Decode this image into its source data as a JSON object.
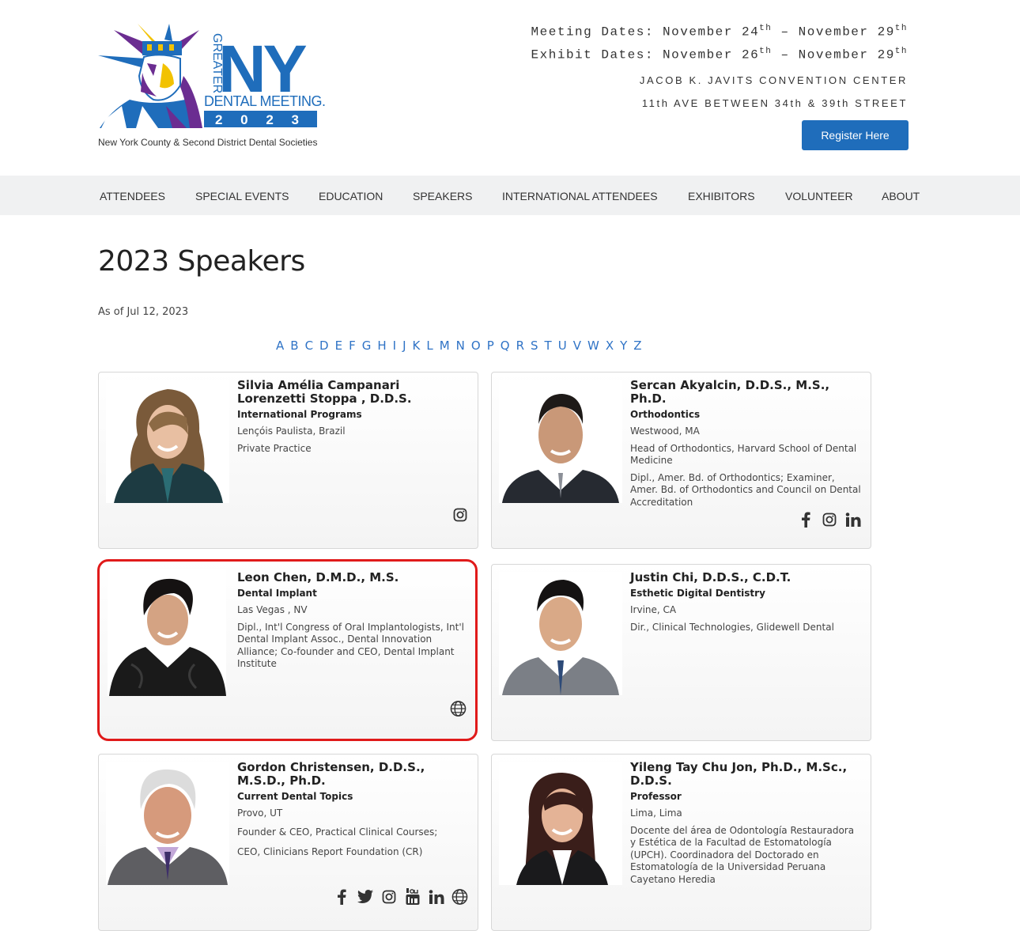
{
  "header": {
    "logo_word_greater": "GREATER",
    "logo_word_ny": "NY",
    "logo_word_dental": "DENTAL MEETING.",
    "logo_year": "2 0 2 3",
    "tagline": "New York County & Second District Dental Societies",
    "meeting_dates_prefix": "Meeting Dates: November 24",
    "meeting_dates_mid": " – November 29",
    "exhibit_dates_prefix": "Exhibit Dates: November 26",
    "exhibit_dates_mid": " – November 29",
    "ordinal_suffix": "th",
    "venue": "JACOB K. JAVITS CONVENTION CENTER",
    "address": "11th AVE BETWEEN 34th & 39th STREET",
    "register_label": "Register Here",
    "brand_blue": "#1f6dbb"
  },
  "nav": {
    "items": [
      "ATTENDEES",
      "SPECIAL EVENTS",
      "EDUCATION",
      "SPEAKERS",
      "INTERNATIONAL ATTENDEES",
      "EXHIBITORS",
      "VOLUNTEER",
      "ABOUT"
    ]
  },
  "page": {
    "title": "2023 Speakers",
    "as_of": "As of Jul 12, 2023",
    "letters": [
      "A",
      "B",
      "C",
      "D",
      "E",
      "F",
      "G",
      "H",
      "I",
      "J",
      "K",
      "L",
      "M",
      "N",
      "O",
      "P",
      "Q",
      "R",
      "S",
      "T",
      "U",
      "V",
      "W",
      "X",
      "Y",
      "Z"
    ]
  },
  "speakers": [
    {
      "name": "Silvia Amélia Campanari Lorenzetti Stoppa , D.D.S.",
      "specialty": "International Programs",
      "lines": [
        "Lençóis Paulista, Brazil",
        "Private Practice"
      ],
      "socials": [
        "instagram-icon"
      ]
    },
    {
      "name": "Sercan Akyalcin, D.D.S., M.S., Ph.D.",
      "specialty": "Orthodontics",
      "lines": [
        "Westwood, MA",
        "Head of Orthodontics, Harvard School of Dental Medicine",
        "Dipl., Amer. Bd. of Orthodontics; Examiner, Amer. Bd. of Orthodontics and Council on Dental Accreditation"
      ],
      "socials": [
        "facebook-icon",
        "instagram-icon",
        "linkedin-icon"
      ]
    },
    {
      "name": "Leon Chen, D.M.D., M.S.",
      "specialty": "Dental Implant",
      "lines": [
        "Las Vegas , NV",
        "Dipl., Int'l Congress of Oral Implantologists, Int'l Dental Implant Assoc., Dental Innovation Alliance; Co-founder and CEO, Dental Implant Institute"
      ],
      "socials": [
        "website-icon"
      ]
    },
    {
      "name": "Justin Chi, D.D.S., C.D.T.",
      "specialty": "Esthetic Digital Dentistry",
      "lines": [
        "Irvine, CA",
        "Dir., Clinical Technologies, Glidewell Dental"
      ],
      "socials": []
    },
    {
      "name": "Gordon Christensen, D.D.S., M.S.D., Ph.D.",
      "specialty": "Current Dental Topics",
      "lines": [
        "Provo, UT",
        "Founder & CEO, Practical Clinical Courses;",
        "CEO, Clinicians Report Foundation (CR)"
      ],
      "socials": [
        "facebook-icon",
        "twitter-icon",
        "instagram-icon",
        "youtube-icon",
        "linkedin-icon",
        "website-icon"
      ]
    },
    {
      "name": "Yileng Tay Chu Jon, Ph.D., M.Sc., D.D.S.",
      "specialty": "Professor",
      "lines": [
        "Lima, Lima",
        "Docente del área de Odontología Restauradora y Estética de la Facultad de Estomatología (UPCH). Coordinadora del Doctorado en Estomatología de la Universidad Peruana Cayetano Heredia"
      ],
      "socials": []
    }
  ]
}
